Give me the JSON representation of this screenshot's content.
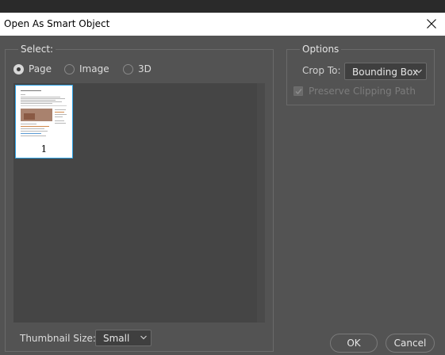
{
  "window": {
    "title": "Open As Smart Object"
  },
  "select_group": {
    "legend": "Select:",
    "radios": [
      {
        "label": "Page",
        "selected": true
      },
      {
        "label": "Image",
        "selected": false
      },
      {
        "label": "3D",
        "selected": false
      }
    ],
    "thumbnails": [
      {
        "page_number": "1",
        "selected": true
      }
    ],
    "thumbnail_size": {
      "label": "Thumbnail Size:",
      "value": "Small"
    }
  },
  "options_group": {
    "legend": "Options",
    "crop_to": {
      "label": "Crop To:",
      "value": "Bounding Box"
    },
    "preserve_clipping": {
      "label": "Preserve Clipping Path",
      "checked": true,
      "enabled": false
    }
  },
  "buttons": {
    "ok": "OK",
    "cancel": "Cancel"
  },
  "colors": {
    "dialog_bg": "#535353",
    "title_bar": "#ffffff",
    "selection_border": "#2fa4e7",
    "thumb_area": "#454545"
  },
  "icons": [
    "close-icon",
    "chevron-down-icon",
    "check-icon"
  ]
}
